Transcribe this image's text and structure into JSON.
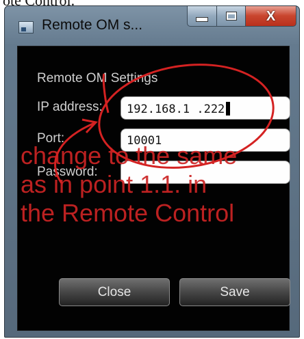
{
  "top_strip_text": "ote Control.",
  "window": {
    "title": "Remote OM s...",
    "minimize_glyph": "",
    "close_glyph": "X"
  },
  "settings": {
    "group_title": "Remote OM Settings",
    "ip_label": "IP address:",
    "ip_value": "192.168.1 .222",
    "port_label": "Port:",
    "port_value": "10001",
    "password_label": "Password:",
    "password_value": ""
  },
  "buttons": {
    "close_label": "Close",
    "save_label": "Save"
  },
  "annotation": {
    "lines": [
      "change to the same",
      "as in point 1.1. in",
      "the Remote Control"
    ],
    "color": "#cc2424"
  }
}
